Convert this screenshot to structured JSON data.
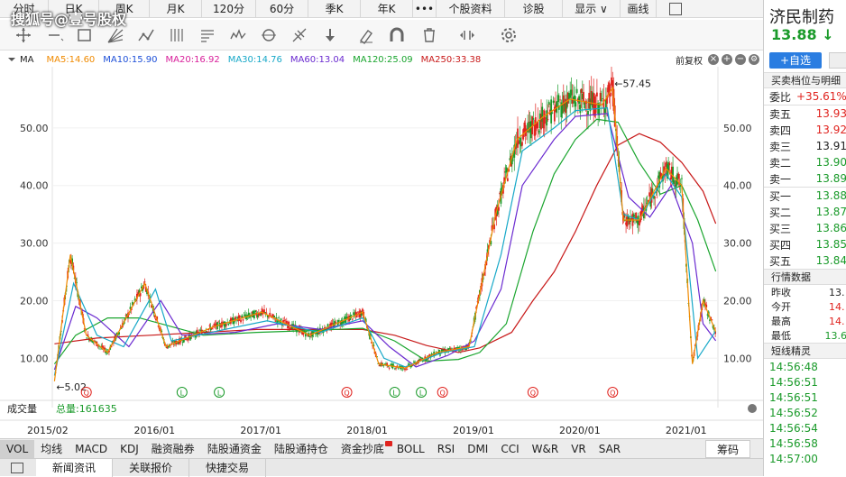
{
  "watermark": "搜狐号@壹号股权",
  "period_tabs": [
    "分时",
    "日K",
    "周K",
    "月K",
    "120分",
    "60分",
    "季K",
    "年K",
    "•••",
    "个股资料",
    "诊股",
    "显示 ∨",
    "画线"
  ],
  "ma_bar": {
    "label": "MA",
    "items": [
      {
        "text": "MA5:14.60",
        "color": "#f08a00"
      },
      {
        "text": "MA10:15.90",
        "color": "#1e50d8"
      },
      {
        "text": "MA20:16.92",
        "color": "#d81e9a"
      },
      {
        "text": "MA30:14.76",
        "color": "#17a8c8"
      },
      {
        "text": "MA60:13.04",
        "color": "#6a2ad0"
      },
      {
        "text": "MA120:25.09",
        "color": "#1aa52e"
      },
      {
        "text": "MA250:33.38",
        "color": "#c81a1a"
      }
    ],
    "adjust": "前复权"
  },
  "chart_data": {
    "type": "candlestick",
    "y_ticks": [
      "50.00",
      "40.00",
      "30.00",
      "20.00",
      "10.00"
    ],
    "ylim": [
      3,
      60
    ],
    "x_labels": [
      "2015/02",
      "2016/01",
      "2017/01",
      "2018/01",
      "2019/01",
      "2020/01",
      "2021/01"
    ],
    "high_annotation": "←57.45",
    "low_annotation": "←5.02",
    "series": [
      {
        "name": "MA250",
        "color": "#c81a1a",
        "values": [
          [
            2015.1,
            12.5
          ],
          [
            2015.5,
            13.5
          ],
          [
            2016.0,
            14
          ],
          [
            2016.5,
            14.5
          ],
          [
            2017.0,
            15
          ],
          [
            2017.5,
            15
          ],
          [
            2018.0,
            15
          ],
          [
            2018.3,
            14
          ],
          [
            2018.6,
            12.2
          ],
          [
            2018.9,
            11
          ],
          [
            2019.1,
            11.8
          ],
          [
            2019.4,
            14.5
          ],
          [
            2019.6,
            20
          ],
          [
            2019.8,
            25
          ],
          [
            2020.0,
            32
          ],
          [
            2020.2,
            40
          ],
          [
            2020.4,
            47
          ],
          [
            2020.6,
            49
          ],
          [
            2020.8,
            47.5
          ],
          [
            2021.0,
            44
          ],
          [
            2021.2,
            39
          ],
          [
            2021.32,
            33.38
          ]
        ]
      },
      {
        "name": "MA120",
        "color": "#1aa52e",
        "values": [
          [
            2015.1,
            9
          ],
          [
            2015.3,
            14
          ],
          [
            2015.6,
            17
          ],
          [
            2015.9,
            17
          ],
          [
            2016.2,
            15.5
          ],
          [
            2016.5,
            14
          ],
          [
            2017.0,
            14.5
          ],
          [
            2017.5,
            14.8
          ],
          [
            2018.0,
            15.2
          ],
          [
            2018.3,
            13
          ],
          [
            2018.6,
            9.5
          ],
          [
            2018.9,
            9.8
          ],
          [
            2019.1,
            11
          ],
          [
            2019.35,
            16
          ],
          [
            2019.6,
            32
          ],
          [
            2019.8,
            42
          ],
          [
            2020.0,
            48
          ],
          [
            2020.2,
            51.5
          ],
          [
            2020.4,
            51
          ],
          [
            2020.6,
            44
          ],
          [
            2020.8,
            38.5
          ],
          [
            2021.0,
            40
          ],
          [
            2021.15,
            34
          ],
          [
            2021.32,
            25.09
          ]
        ]
      },
      {
        "name": "MA60",
        "color": "#6a2ad0",
        "values": [
          [
            2015.1,
            8
          ],
          [
            2015.3,
            19
          ],
          [
            2015.5,
            17
          ],
          [
            2015.8,
            12
          ],
          [
            2016.1,
            20
          ],
          [
            2016.3,
            14
          ],
          [
            2016.8,
            14.5
          ],
          [
            2017.2,
            16
          ],
          [
            2017.6,
            15
          ],
          [
            2018.0,
            16.5
          ],
          [
            2018.25,
            12
          ],
          [
            2018.5,
            8.5
          ],
          [
            2018.8,
            10.5
          ],
          [
            2019.05,
            13
          ],
          [
            2019.3,
            22
          ],
          [
            2019.5,
            40
          ],
          [
            2019.8,
            48
          ],
          [
            2020.0,
            52
          ],
          [
            2020.3,
            52.5
          ],
          [
            2020.5,
            38
          ],
          [
            2020.7,
            34.5
          ],
          [
            2020.9,
            40
          ],
          [
            2021.1,
            30
          ],
          [
            2021.2,
            16
          ],
          [
            2021.32,
            13.04
          ]
        ]
      },
      {
        "name": "MA30",
        "color": "#17a8c8",
        "values": [
          [
            2015.1,
            7
          ],
          [
            2015.28,
            23
          ],
          [
            2015.5,
            14
          ],
          [
            2015.75,
            12
          ],
          [
            2016.05,
            22
          ],
          [
            2016.2,
            13
          ],
          [
            2016.7,
            15
          ],
          [
            2017.1,
            16.5
          ],
          [
            2017.6,
            14.5
          ],
          [
            2018.0,
            17
          ],
          [
            2018.2,
            10
          ],
          [
            2018.4,
            8.5
          ],
          [
            2018.75,
            11
          ],
          [
            2019.05,
            12
          ],
          [
            2019.3,
            28
          ],
          [
            2019.5,
            46
          ],
          [
            2019.8,
            50
          ],
          [
            2020.0,
            53
          ],
          [
            2020.3,
            53.5
          ],
          [
            2020.45,
            35
          ],
          [
            2020.6,
            34
          ],
          [
            2020.85,
            42
          ],
          [
            2021.0,
            38
          ],
          [
            2021.15,
            10
          ],
          [
            2021.32,
            14.76
          ]
        ]
      },
      {
        "name": "MA5",
        "color": "#f08a00",
        "values": [
          [
            2015.1,
            6
          ],
          [
            2015.25,
            28
          ],
          [
            2015.4,
            14
          ],
          [
            2015.6,
            11
          ],
          [
            2015.95,
            23
          ],
          [
            2016.15,
            12
          ],
          [
            2016.6,
            15.5
          ],
          [
            2017.05,
            18
          ],
          [
            2017.5,
            14
          ],
          [
            2018.0,
            18
          ],
          [
            2018.15,
            9
          ],
          [
            2018.4,
            8.3
          ],
          [
            2018.7,
            11
          ],
          [
            2019.0,
            12
          ],
          [
            2019.25,
            35
          ],
          [
            2019.45,
            48
          ],
          [
            2019.7,
            52
          ],
          [
            2019.95,
            55
          ],
          [
            2020.25,
            54
          ],
          [
            2020.35,
            57
          ],
          [
            2020.45,
            34
          ],
          [
            2020.6,
            34
          ],
          [
            2020.85,
            43
          ],
          [
            2021.0,
            40
          ],
          [
            2021.1,
            9
          ],
          [
            2021.2,
            20
          ],
          [
            2021.32,
            14.6
          ]
        ]
      }
    ],
    "markers": [
      "Q",
      "L",
      "L",
      "Q",
      "L",
      "L",
      "Q",
      "Q",
      "Q"
    ]
  },
  "volume": {
    "label": "成交量",
    "total": "总量:161635"
  },
  "indicator_tabs": [
    "VOL",
    "均线",
    "MACD",
    "KDJ",
    "融资融券",
    "陆股通资金",
    "陆股通持仓",
    "资金抄底",
    "BOLL",
    "RSI",
    "DMI",
    "CCI",
    "W&R",
    "VR",
    "SAR",
    "筹码"
  ],
  "news_tabs": [
    "新闻资讯",
    "关联报价",
    "快捷交易"
  ],
  "stock": {
    "name": "济民制药",
    "price": "13.88",
    "arrow": "↓",
    "add_button": "+自选",
    "order_title": "买卖档位与明细",
    "ratio_label": "委比",
    "ratio_value": "+35.61%",
    "asks": [
      {
        "label": "卖五",
        "price": "13.93",
        "color": "#e0231e"
      },
      {
        "label": "卖四",
        "price": "13.92",
        "color": "#e0231e"
      },
      {
        "label": "卖三",
        "price": "13.91",
        "color": "#222"
      },
      {
        "label": "卖二",
        "price": "13.90",
        "color": "#1a9a2a"
      },
      {
        "label": "卖一",
        "price": "13.89",
        "color": "#1a9a2a"
      }
    ],
    "bids": [
      {
        "label": "买一",
        "price": "13.88",
        "color": "#1a9a2a"
      },
      {
        "label": "买二",
        "price": "13.87",
        "color": "#1a9a2a"
      },
      {
        "label": "买三",
        "price": "13.86",
        "color": "#1a9a2a"
      },
      {
        "label": "买四",
        "price": "13.85",
        "color": "#1a9a2a"
      },
      {
        "label": "买五",
        "price": "13.84",
        "color": "#1a9a2a"
      }
    ],
    "quote_title": "行情数据",
    "quotes": [
      {
        "label": "昨收",
        "value": "13.",
        "color": "#222"
      },
      {
        "label": "今开",
        "value": "14.",
        "color": "#e0231e"
      },
      {
        "label": "最高",
        "value": "14.",
        "color": "#e0231e"
      },
      {
        "label": "最低",
        "value": "13.6",
        "color": "#1a9a2a"
      }
    ],
    "short_title": "短线精灵",
    "short_times": [
      "14:56:48",
      "14:56:51",
      "14:56:51",
      "14:56:52",
      "14:56:54",
      "14:56:58",
      "14:57:00"
    ]
  }
}
